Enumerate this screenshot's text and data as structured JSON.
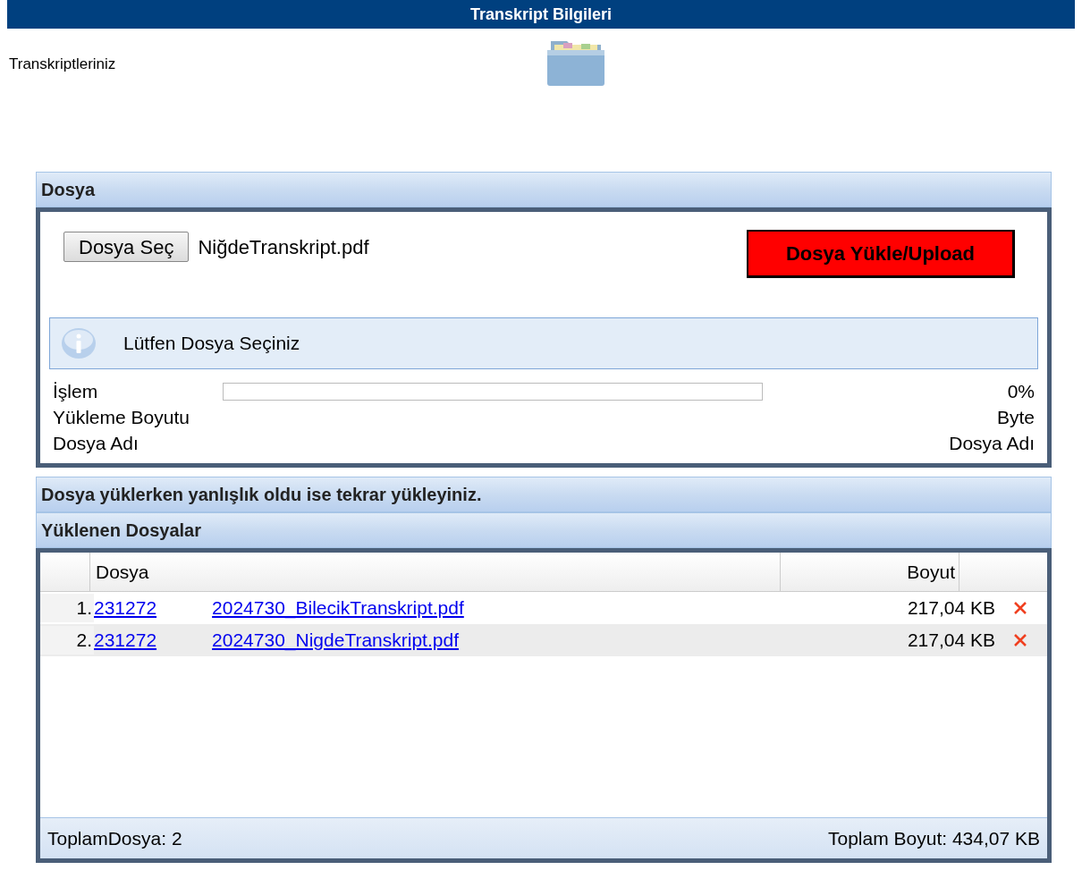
{
  "header": {
    "title": "Transkript Bilgileri"
  },
  "intro": {
    "label": "Transkriptleriniz"
  },
  "upload_panel": {
    "title": "Dosya",
    "choose_button": "Dosya Seç",
    "chosen_file": "NiğdeTranskript.pdf",
    "upload_button": "Dosya Yükle/Upload",
    "info_message": "Lütfen Dosya Seçiniz",
    "rows": [
      {
        "label": "İşlem",
        "level": 0,
        "value": "0%"
      },
      {
        "label": "Yükleme Boyutu",
        "value": "Byte"
      },
      {
        "label": "Dosya Adı",
        "value": "Dosya Adı"
      }
    ]
  },
  "notice": "Dosya yüklerken yanlışlık oldu ise tekrar yükleyiniz.",
  "files_panel": {
    "title": "Yüklenen Dosyalar",
    "columns": [
      "Dosya",
      "Boyut"
    ],
    "rows": [
      {
        "number": "1.",
        "name_start": "231272",
        "name_end": "2024730_BilecikTranskript.pdf",
        "size": "217,04 KB"
      },
      {
        "number": "2.",
        "name_start": "231272",
        "name_end": "2024730_NigdeTranskript.pdf",
        "size": "217,04 KB"
      }
    ],
    "footer_left": "ToplamDosya: 2",
    "footer_right": "Toplam Boyut: 434,07 KB"
  }
}
